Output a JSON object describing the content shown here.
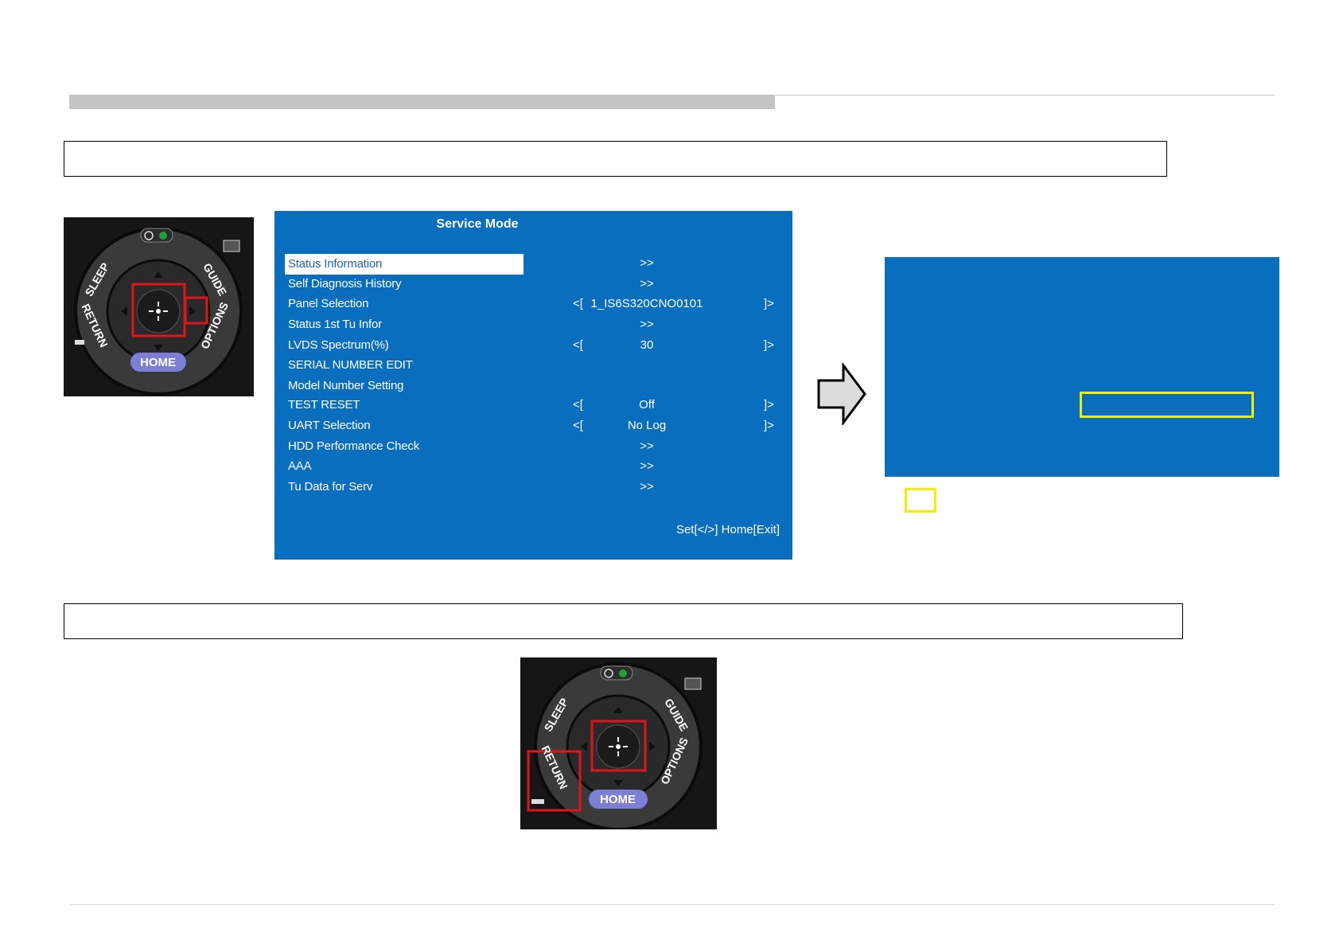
{
  "service_mode": {
    "title": "Service Mode",
    "items": [
      {
        "label": "Status Information",
        "value": ">>",
        "selected": true
      },
      {
        "label": "Self Diagnosis History",
        "value": ">>"
      },
      {
        "label": "Panel Selection",
        "left": "<[",
        "value": "1_IS6S320CNO0101",
        "right": "]>"
      },
      {
        "label": "Status 1st Tu Infor",
        "value": ">>"
      },
      {
        "label": "LVDS Spectrum(%)",
        "left": "<[",
        "value": "30",
        "right": "]>"
      },
      {
        "label": "SERIAL NUMBER EDIT",
        "value": ""
      },
      {
        "label": "Model Number Setting",
        "value": ""
      },
      {
        "label": "TEST RESET",
        "left": "<[",
        "value": "Off",
        "right": "]>"
      },
      {
        "label": "UART Selection",
        "left": "<[",
        "value": "No Log",
        "right": "]>"
      },
      {
        "label": "HDD Performance Check",
        "value": ">>"
      },
      {
        "label": "AAA",
        "value": ">>"
      },
      {
        "label": "Tu Data for Serv",
        "value": ">>"
      }
    ],
    "footer": "Set[</>] Home[Exit]"
  },
  "remote": {
    "labels": {
      "sleep": "SLEEP",
      "guide": "GUIDE",
      "return": "RETURN",
      "options": "OPTIONS",
      "home": "HOME"
    }
  },
  "colors": {
    "screen_blue": "#0a6ebf",
    "highlight_red": "#e0141e",
    "highlight_yellow": "#f2f000"
  }
}
